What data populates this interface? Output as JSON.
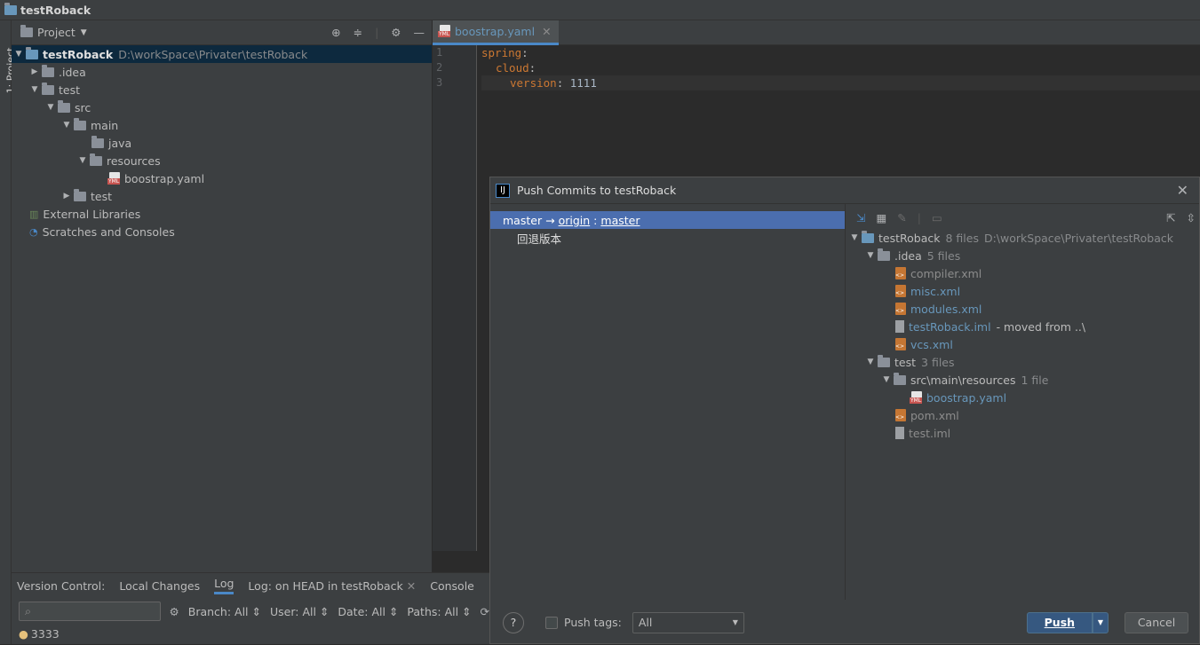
{
  "window": {
    "title": "testRoback"
  },
  "stripe": {
    "label": "1: Project"
  },
  "project": {
    "header": "Project",
    "tree": [
      {
        "label": "testRoback",
        "path": "D:\\workSpace\\Privater\\testRoback"
      },
      {
        "label": ".idea"
      },
      {
        "label": "test"
      },
      {
        "label": "src"
      },
      {
        "label": "main"
      },
      {
        "label": "java"
      },
      {
        "label": "resources"
      },
      {
        "label": "boostrap.yaml"
      },
      {
        "label": "test"
      },
      {
        "label": "External Libraries"
      },
      {
        "label": "Scratches and Consoles"
      }
    ]
  },
  "editor": {
    "tab": "boostrap.yaml",
    "lines": [
      {
        "num": "1",
        "key": "spring",
        "sep": ":"
      },
      {
        "num": "2",
        "key": "cloud",
        "sep": ":"
      },
      {
        "num": "3",
        "key": "version",
        "sep": ": ",
        "value": "1111"
      }
    ]
  },
  "vc": {
    "tabs": [
      "Version Control:",
      "Local Changes",
      "Log",
      "Log: on HEAD in testRoback",
      "Console"
    ],
    "filters": [
      "Branch: All",
      "User: All",
      "Date: All",
      "Paths: All"
    ],
    "commit": "3333"
  },
  "dialog": {
    "title": "Push Commits to testRoback",
    "branch": {
      "local": "master",
      "arrow": "→",
      "remote": "origin",
      "sep": ":",
      "target": "master"
    },
    "commit_msg": "回退版本",
    "files": [
      {
        "label": "testRoback",
        "count": "8 files",
        "path": "D:\\workSpace\\Privater\\testRoback"
      },
      {
        "label": ".idea",
        "count": "5 files"
      },
      {
        "label": "compiler.xml"
      },
      {
        "label": "misc.xml"
      },
      {
        "label": "modules.xml"
      },
      {
        "label": "testRoback.iml",
        "note": "- moved from ..\\"
      },
      {
        "label": "vcs.xml"
      },
      {
        "label": "test",
        "count": "3 files"
      },
      {
        "label": "src\\main\\resources",
        "count": "1 file"
      },
      {
        "label": "boostrap.yaml"
      },
      {
        "label": "pom.xml"
      },
      {
        "label": "test.iml"
      }
    ],
    "push_tags_label": "Push tags:",
    "tags_select": "All",
    "push_button": "Push",
    "cancel_button": "Cancel"
  }
}
